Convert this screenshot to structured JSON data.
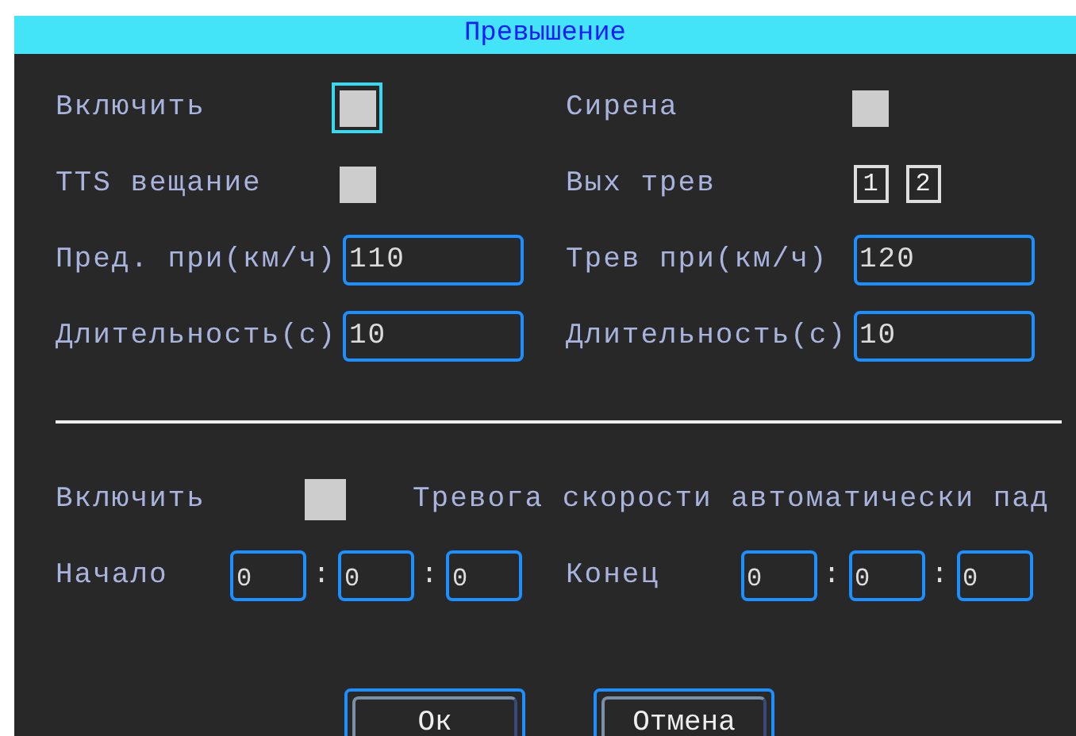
{
  "dialog": {
    "title": "Превышение"
  },
  "fields": [
    {
      "kind": "checkbox",
      "label": "Включить",
      "checked": false,
      "focused": true
    },
    {
      "kind": "checkbox",
      "label": "Сирена",
      "checked": false,
      "focused": false
    },
    {
      "kind": "checkbox",
      "label": "TTS вещание",
      "checked": false,
      "focused": false
    },
    {
      "kind": "outputs",
      "label": "Вых трев",
      "outputs": [
        {
          "label": "1"
        },
        {
          "label": "2"
        }
      ]
    },
    {
      "kind": "input",
      "label": "Пред. при(км/ч)",
      "value": "110"
    },
    {
      "kind": "input",
      "label": "Трев при(км/ч)",
      "value": "120"
    },
    {
      "kind": "input",
      "label": "Длительность(с)",
      "value": "10"
    },
    {
      "kind": "input",
      "label": "Длительность(с)",
      "value": "10"
    }
  ],
  "auto": {
    "enable": {
      "label": "Включить",
      "checked": false
    },
    "note": "Тревога скорости автоматически пад",
    "start": {
      "label": "Начало",
      "values": [
        "0",
        "0",
        "0"
      ],
      "separators": [
        ":",
        ":"
      ]
    },
    "end": {
      "label": "Конец",
      "values": [
        "0",
        "0",
        "0"
      ],
      "separators": [
        ":",
        ":"
      ]
    }
  },
  "buttons": [
    "Ок",
    "Отмена"
  ]
}
